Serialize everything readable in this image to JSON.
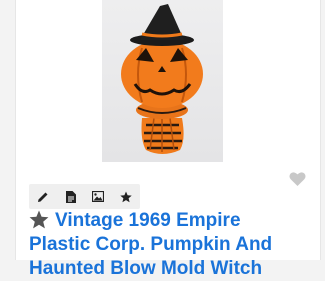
{
  "listing": {
    "title_line1": "Vintage 1969 Empire",
    "title_line2": "Plastic Corp. Pumpkin And",
    "title_line3": "Haunted Blow Mold Witch"
  },
  "icons": {
    "favorite": "heart-icon",
    "edit": "pencil-icon",
    "document": "document-icon",
    "image": "image-icon",
    "star": "star-icon"
  },
  "colors": {
    "title": "#1a73d9",
    "icon_dark": "#222222",
    "star_title": "#555555",
    "heart": "#c8c8c8"
  }
}
